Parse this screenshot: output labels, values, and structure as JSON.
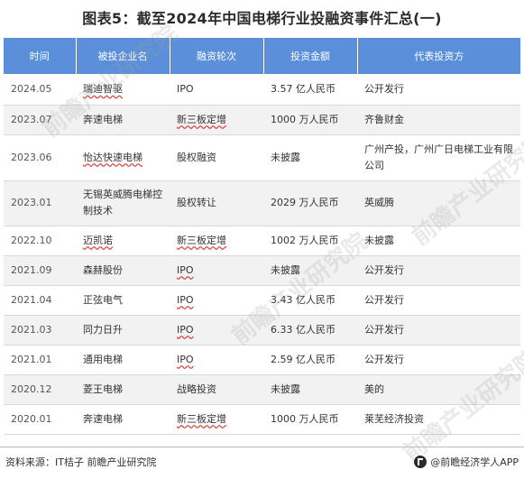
{
  "title": "图表5：截至2024年中国电梯行业投融资事件汇总(一)",
  "table": {
    "headers": [
      "时间",
      "被投企业名",
      "融资轮次",
      "投资金额",
      "代表投资方"
    ],
    "rows": [
      {
        "date": "2024.05",
        "company": "瑞迪智驱",
        "round": "IPO",
        "amount": "3.57 亿人民币",
        "investor": "公开发行"
      },
      {
        "date": "2023.07",
        "company": "奔速电梯",
        "round": "新三板定增",
        "amount": "1000 万人民币",
        "investor": "齐鲁财金"
      },
      {
        "date": "2023.06",
        "company": "怡达快速电梯",
        "round": "股权融资",
        "amount": "未披露",
        "investor": "广州产投，广州广日电梯工业有限公司"
      },
      {
        "date": "2023.01",
        "company": "无锡英威腾电梯控制技术",
        "round": "股权转让",
        "amount": "2029 万人民币",
        "investor": "英威腾"
      },
      {
        "date": "2022.10",
        "company": "迈凯诺",
        "round": "新三板定增",
        "amount": "1002 万人民币",
        "investor": "未披露"
      },
      {
        "date": "2021.09",
        "company": "森赫股份",
        "round": "IPO",
        "amount": "未披露",
        "investor": "公开发行"
      },
      {
        "date": "2021.04",
        "company": "正弦电气",
        "round": "IPO",
        "amount": "3.43 亿人民币",
        "investor": "公开发行"
      },
      {
        "date": "2021.03",
        "company": "同力日升",
        "round": "IPO",
        "amount": "6.33 亿人民币",
        "investor": "公开发行"
      },
      {
        "date": "2021.01",
        "company": "通用电梯",
        "round": "IPO",
        "amount": "2.59 亿人民币",
        "investor": "公开发行"
      },
      {
        "date": "2020.12",
        "company": "菱王电梯",
        "round": "战略投资",
        "amount": "未披露",
        "investor": "美的"
      },
      {
        "date": "2020.01",
        "company": "奔速电梯",
        "round": "新三板定增",
        "amount": "1000 万人民币",
        "investor": "莱芜经济投资"
      }
    ]
  },
  "watermark_text": "前瞻产业研究院",
  "footer": {
    "source": "资料来源：IT桔子 前瞻产业研究院",
    "brand": "@前瞻经济学人APP"
  }
}
